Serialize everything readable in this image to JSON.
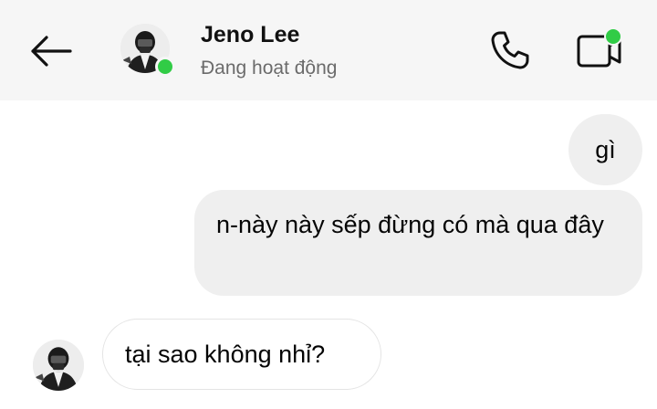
{
  "header": {
    "contact_name": "Jeno Lee",
    "status_text": "Đang hoạt động",
    "back_icon": "arrow-left-icon",
    "call_icon": "phone-icon",
    "video_icon": "video-camera-icon",
    "online_color": "#31cc46"
  },
  "messages": [
    {
      "direction": "outgoing",
      "text": "gì"
    },
    {
      "direction": "outgoing",
      "text": "n-này này sếp đừng có mà qua đây"
    },
    {
      "direction": "incoming",
      "text": "tại sao không nhỉ?"
    }
  ],
  "colors": {
    "header_bg": "#f6f6f6",
    "outgoing_bubble": "#efefef",
    "incoming_border": "#e4e4e4"
  }
}
